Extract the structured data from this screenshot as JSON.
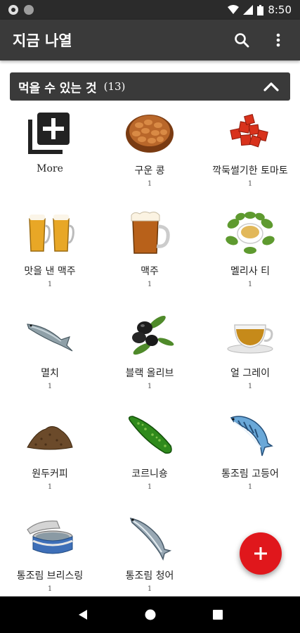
{
  "status_bar": {
    "time": "8:50"
  },
  "app_bar": {
    "title": "지금 나열"
  },
  "section": {
    "title": "먹을 수 있는 것",
    "count": "(13)"
  },
  "more": {
    "label": "More"
  },
  "items": [
    {
      "label": "구운 콩",
      "qty": "1",
      "icon": "roasted-beans-icon"
    },
    {
      "label": "깍둑썰기한 토마토",
      "qty": "1",
      "icon": "diced-tomato-icon"
    },
    {
      "label": "맛을 낸 맥주",
      "qty": "1",
      "icon": "flavored-beer-icon"
    },
    {
      "label": "맥주",
      "qty": "1",
      "icon": "beer-mug-icon"
    },
    {
      "label": "멜리사 티",
      "qty": "1",
      "icon": "melissa-tea-icon"
    },
    {
      "label": "멸치",
      "qty": "1",
      "icon": "anchovy-icon"
    },
    {
      "label": "블랙 올리브",
      "qty": "1",
      "icon": "black-olive-icon"
    },
    {
      "label": "얼 그레이",
      "qty": "1",
      "icon": "earl-grey-tea-icon"
    },
    {
      "label": "원두커피",
      "qty": "1",
      "icon": "coffee-grounds-icon"
    },
    {
      "label": "코르니숑",
      "qty": "1",
      "icon": "cornichon-icon"
    },
    {
      "label": "통조림 고등어",
      "qty": "1",
      "icon": "canned-mackerel-icon"
    },
    {
      "label": "통조림 브리스링",
      "qty": "1",
      "icon": "canned-brisling-icon"
    },
    {
      "label": "통조림 청어",
      "qty": "1",
      "icon": "canned-herring-icon"
    }
  ],
  "colors": {
    "app_bar": "#3a3a3a",
    "fab": "#e0171c",
    "status_bar": "#2b2b2b"
  }
}
